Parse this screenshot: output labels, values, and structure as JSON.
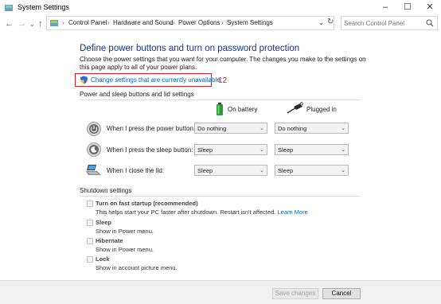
{
  "window": {
    "title": "System Settings"
  },
  "address": {
    "crumbs": [
      "Control Panel",
      "Hardware and Sound",
      "Power Options",
      "System Settings"
    ],
    "search_placeholder": "Search Control Panel"
  },
  "content": {
    "heading": "Define power buttons and turn on password protection",
    "description": "Choose the power settings that you want for your computer. The changes you make to the settings on this page apply to all of your power plans.",
    "change_link": "Change settings that are currently unavailable",
    "annotation_number": "12",
    "section_power": "Power and sleep buttons and lid settings",
    "col_battery": "On battery",
    "col_plugged": "Plugged in",
    "rows": [
      {
        "label": "When I press the power button:",
        "battery": "Do nothing",
        "plugged": "Do nothing"
      },
      {
        "label": "When I press the sleep button:",
        "battery": "Sleep",
        "plugged": "Sleep"
      },
      {
        "label": "When I close the lid:",
        "battery": "Sleep",
        "plugged": "Sleep"
      }
    ],
    "section_shutdown": "Shutdown settings",
    "shutdown": [
      {
        "title": "Turn on fast startup (recommended)",
        "desc": "This helps start your PC faster after shutdown. Restart isn't affected.",
        "link": "Learn More"
      },
      {
        "title": "Sleep",
        "desc": "Show in Power menu."
      },
      {
        "title": "Hibernate",
        "desc": "Show in Power menu."
      },
      {
        "title": "Lock",
        "desc": "Show in account picture menu."
      }
    ]
  },
  "footer": {
    "save_label": "Save changes",
    "cancel_label": "Cancel"
  },
  "colors": {
    "heading": "#1e3287",
    "link": "#0066cc",
    "highlight": "#e02020"
  }
}
